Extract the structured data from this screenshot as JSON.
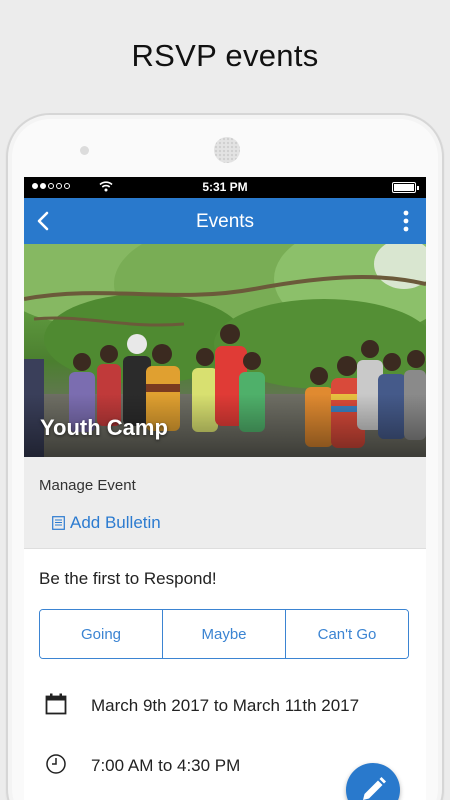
{
  "promo": {
    "title": "RSVP events"
  },
  "status_bar": {
    "time": "5:31 PM"
  },
  "app_bar": {
    "title": "Events"
  },
  "event": {
    "title": "Youth Camp"
  },
  "manage": {
    "label": "Manage Event",
    "add_bulletin": "Add Bulletin"
  },
  "respond": {
    "label": "Be the first to Respond!",
    "options": [
      "Going",
      "Maybe",
      "Can't Go"
    ]
  },
  "details": {
    "dates": "March 9th 2017 to March 11th 2017",
    "time": "7:00 AM to 4:30 PM"
  },
  "colors": {
    "accent": "#2979cc",
    "link": "#2c7bd0",
    "background": "#ececec"
  },
  "icons": {
    "back": "chevron-left-icon",
    "menu": "more-vertical-icon",
    "bulletin": "document-icon",
    "calendar": "calendar-icon",
    "clock": "clock-icon",
    "fab": "pencil-icon"
  }
}
